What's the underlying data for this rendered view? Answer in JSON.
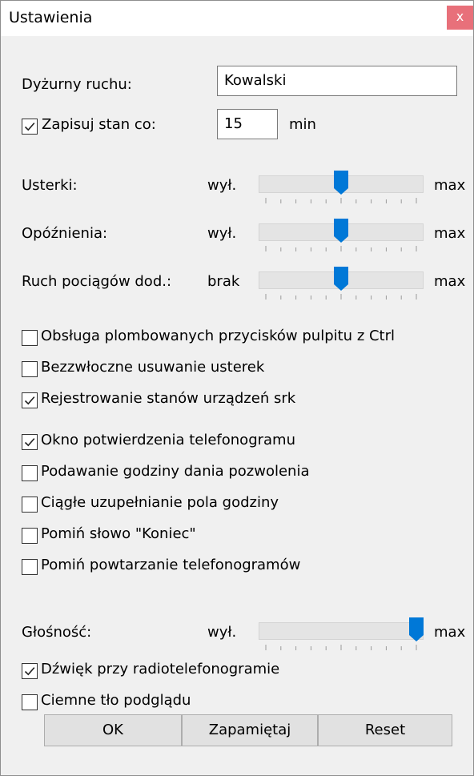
{
  "window": {
    "title": "Ustawienia",
    "close_glyph": "x"
  },
  "dispatcher": {
    "label": "Dyżurny ruchu:",
    "value": "Kowalski"
  },
  "autosave": {
    "checked": true,
    "label": "Zapisuj stan co:",
    "value": "15",
    "unit": "min"
  },
  "sliders": [
    {
      "label": "Usterki:",
      "min_label": "wył.",
      "max_label": "max",
      "value": 0.5
    },
    {
      "label": "Opóźnienia:",
      "min_label": "wył.",
      "max_label": "max",
      "value": 0.5
    },
    {
      "label": "Ruch pociągów dod.:",
      "min_label": "brak",
      "max_label": "max",
      "value": 0.5
    }
  ],
  "options_group1": [
    {
      "label": "Obsługa plombowanych przycisków pulpitu z Ctrl",
      "checked": false
    },
    {
      "label": "Bezzwłoczne usuwanie usterek",
      "checked": false
    },
    {
      "label": "Rejestrowanie stanów urządzeń srk",
      "checked": true
    }
  ],
  "options_group2": [
    {
      "label": "Okno potwierdzenia telefonogramu",
      "checked": true
    },
    {
      "label": "Podawanie godziny dania pozwolenia",
      "checked": false
    },
    {
      "label": "Ciągłe uzupełnianie pola godziny",
      "checked": false
    },
    {
      "label": "Pomiń słowo \"Koniec\"",
      "checked": false
    },
    {
      "label": "Pomiń powtarzanie telefonogramów",
      "checked": false
    }
  ],
  "volume": {
    "label": "Głośność:",
    "min_label": "wył.",
    "max_label": "max",
    "value": 1.0
  },
  "options_group3": [
    {
      "label": "Dźwięk przy radiotelefonogramie",
      "checked": true
    },
    {
      "label": "Ciemne tło podglądu",
      "checked": false
    }
  ],
  "buttons": {
    "ok": "OK",
    "save": "Zapamiętaj",
    "reset": "Reset"
  },
  "colors": {
    "accent": "#0078d7",
    "close": "#e8707a",
    "background": "#f0f0f0"
  }
}
